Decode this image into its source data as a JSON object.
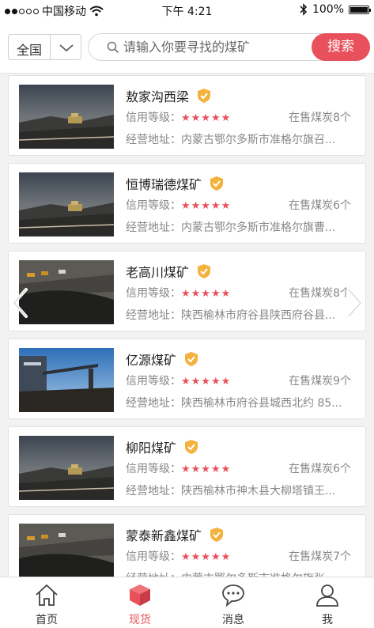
{
  "status_bar": {
    "carrier": "中国移动",
    "time": "下午 4:21",
    "battery": "100%"
  },
  "header": {
    "region_label": "全国",
    "search_placeholder": "请输入你要寻找的煤矿",
    "search_button": "搜索"
  },
  "labels": {
    "credit": "信用等级：",
    "address": "经营地址："
  },
  "mines": [
    {
      "name": "敖家沟西梁",
      "stars": "★★★★★",
      "stock": "在售煤炭8个",
      "address": "内蒙古鄂尔多斯市准格尔旗召..."
    },
    {
      "name": "恒博瑞德煤矿",
      "stars": "★★★★★",
      "stock": "在售煤炭6个",
      "address": "内蒙古鄂尔多斯市准格尔旗曹..."
    },
    {
      "name": "老高川煤矿",
      "stars": "★★★★★",
      "stock": "在售煤炭8个",
      "address": "陕西榆林市府谷县陕西府谷县..."
    },
    {
      "name": "亿源煤矿",
      "stars": "★★★★★",
      "stock": "在售煤炭9个",
      "address": "陕西榆林市府谷县城西北约 85..."
    },
    {
      "name": "柳阳煤矿",
      "stars": "★★★★★",
      "stock": "在售煤炭6个",
      "address": "陕西榆林市神木县大柳塔镇王..."
    },
    {
      "name": "蒙泰新鑫煤矿",
      "stars": "★★★★★",
      "stock": "在售煤炭7个",
      "address": "内蒙古鄂尔多斯市准格尔旗张..."
    }
  ],
  "tabs": [
    {
      "label": "首页",
      "icon": "home-icon"
    },
    {
      "label": "现货",
      "icon": "cube-icon"
    },
    {
      "label": "消息",
      "icon": "message-icon"
    },
    {
      "label": "我",
      "icon": "user-icon"
    }
  ],
  "colors": {
    "accent": "#e8505b",
    "badge": "#f3b23e"
  }
}
